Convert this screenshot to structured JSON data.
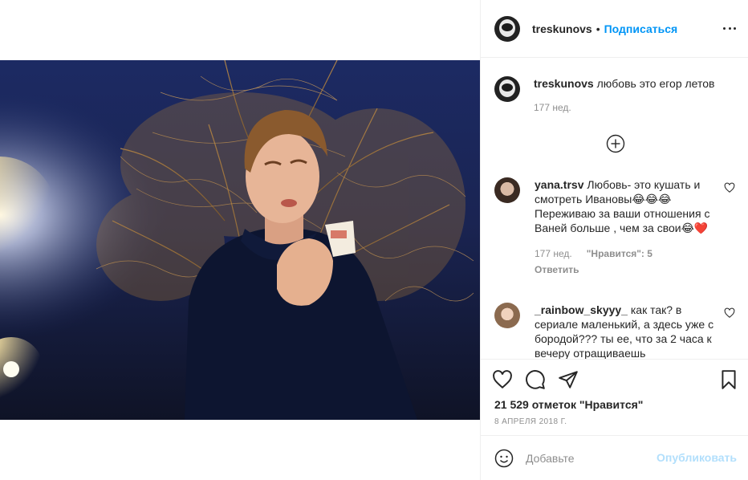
{
  "post": {
    "author": "treskunovs",
    "follow_label": "Подписаться",
    "dot": "•",
    "caption": {
      "username": "treskunovs",
      "text": "любовь это егор летов",
      "time": "177 нед."
    },
    "comments": [
      {
        "username": "yana.trsv",
        "text": "Любовь- это кушать и смотреть Ивановы😂😂😂 Переживаю за ваши отношения с Ваней больше , чем за свои😂❤️",
        "time": "177 нед.",
        "likes": "\"Нравится\": 5",
        "reply_label": "Ответить"
      },
      {
        "username": "_rainbow_skyyy_",
        "text": "как так? в сериале маленький, а здесь уже с бородой??? ты ее, что за 2 часа к вечеру отращиваешь"
      }
    ],
    "likes_text": "21 529 отметок \"Нравится\"",
    "date": "8 АПРЕЛЯ 2018 Г.",
    "comment_placeholder": "Добавьте",
    "publish_label": "Опубликовать"
  },
  "icons": {
    "more": "more-options-icon",
    "load_more": "plus-circle-icon",
    "like": "heart-icon",
    "comment": "comment-icon",
    "share": "paper-plane-icon",
    "save": "bookmark-icon",
    "emoji": "emoji-icon"
  },
  "colors": {
    "link_blue": "#0095f6",
    "disabled_blue": "#b2dffc",
    "text": "#262626",
    "muted": "#8e8e8e"
  }
}
